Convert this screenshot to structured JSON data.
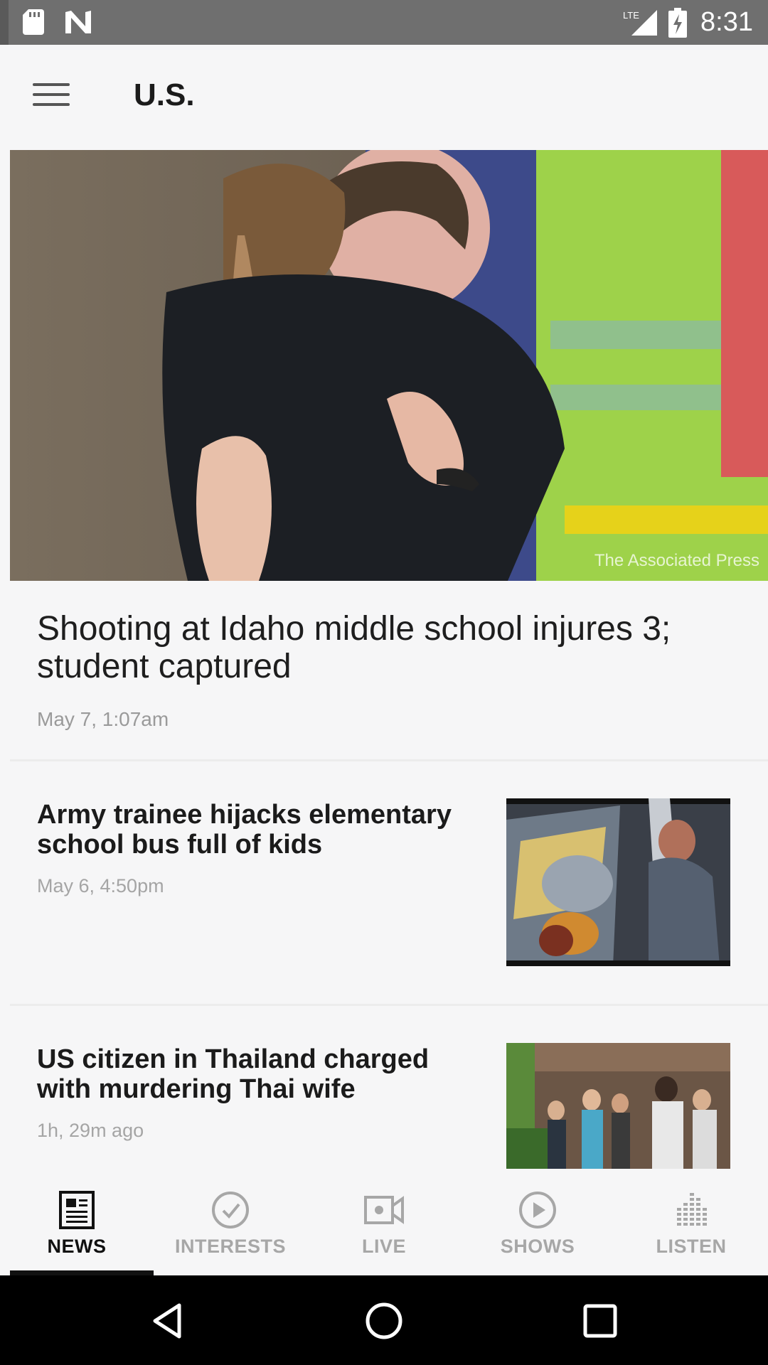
{
  "status_bar": {
    "time": "8:31",
    "network": "LTE",
    "icons": [
      "sd-card-icon",
      "n-app-icon",
      "signal-icon",
      "battery-charging-icon"
    ]
  },
  "header": {
    "title": "U.S.",
    "menu_icon": "hamburger-menu-icon"
  },
  "hero": {
    "headline": "Shooting at Idaho middle school injures 3; student captured",
    "timestamp": "May 7, 1:07am",
    "credit": "The Associated Press"
  },
  "stories": [
    {
      "title": "Army trainee hijacks elementary school bus full of kids",
      "timestamp": "May 6, 4:50pm"
    },
    {
      "title": "US citizen in Thailand charged with murdering Thai wife",
      "timestamp": "1h, 29m ago"
    }
  ],
  "bottom_nav": {
    "active": "NEWS",
    "active_color": "#111111",
    "inactive_color": "#a7a7a7",
    "items": [
      {
        "label": "NEWS",
        "icon": "newspaper-icon"
      },
      {
        "label": "INTERESTS",
        "icon": "checkmark-circle-icon"
      },
      {
        "label": "LIVE",
        "icon": "video-camera-icon"
      },
      {
        "label": "SHOWS",
        "icon": "play-circle-icon"
      },
      {
        "label": "LISTEN",
        "icon": "audio-bars-icon"
      }
    ]
  },
  "system_nav": [
    "back-icon",
    "home-icon",
    "recents-icon"
  ]
}
